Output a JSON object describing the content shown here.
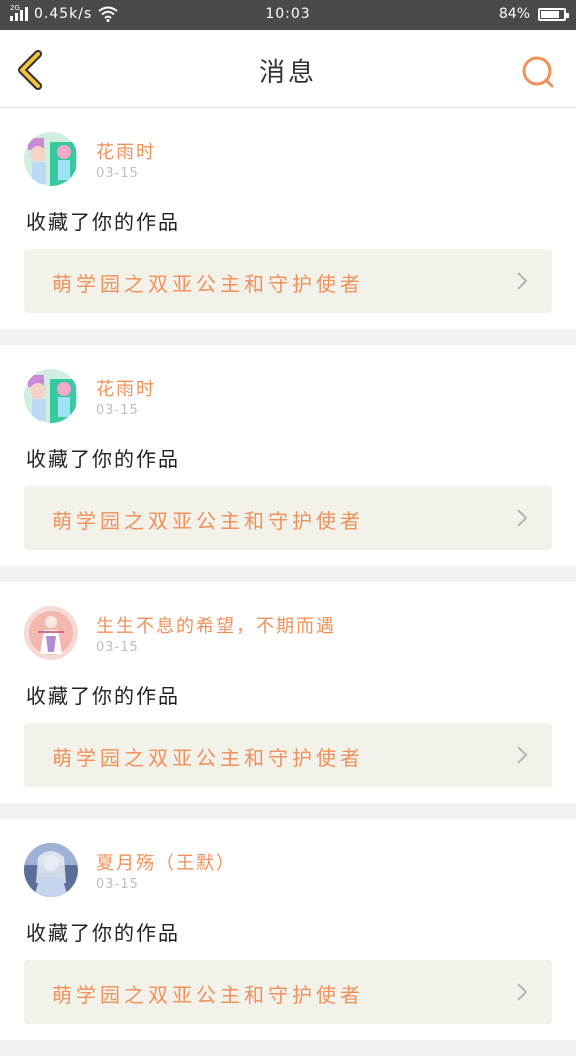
{
  "status_bar": {
    "network": "2G",
    "speed": "0.45k/s",
    "time": "10:03",
    "battery": "84%",
    "battery_level": 0.84
  },
  "header": {
    "title": "消息"
  },
  "colors": {
    "accent": "#f0905a",
    "back_icon": "#f2c43a",
    "card_link_bg": "#f3f2ea",
    "page_bg": "#f2f2f0"
  },
  "messages": [
    {
      "user": "花雨时",
      "date": "03-15",
      "action": "收藏了你的作品",
      "work": "萌学园之双亚公主和守护使者"
    },
    {
      "user": "花雨时",
      "date": "03-15",
      "action": "收藏了你的作品",
      "work": "萌学园之双亚公主和守护使者"
    },
    {
      "user": "生生不息的希望，不期而遇",
      "date": "03-15",
      "action": "收藏了你的作品",
      "work": "萌学园之双亚公主和守护使者"
    },
    {
      "user": "夏月殇（王默）",
      "date": "03-15",
      "action": "收藏了你的作品",
      "work": "萌学园之双亚公主和守护使者"
    }
  ]
}
